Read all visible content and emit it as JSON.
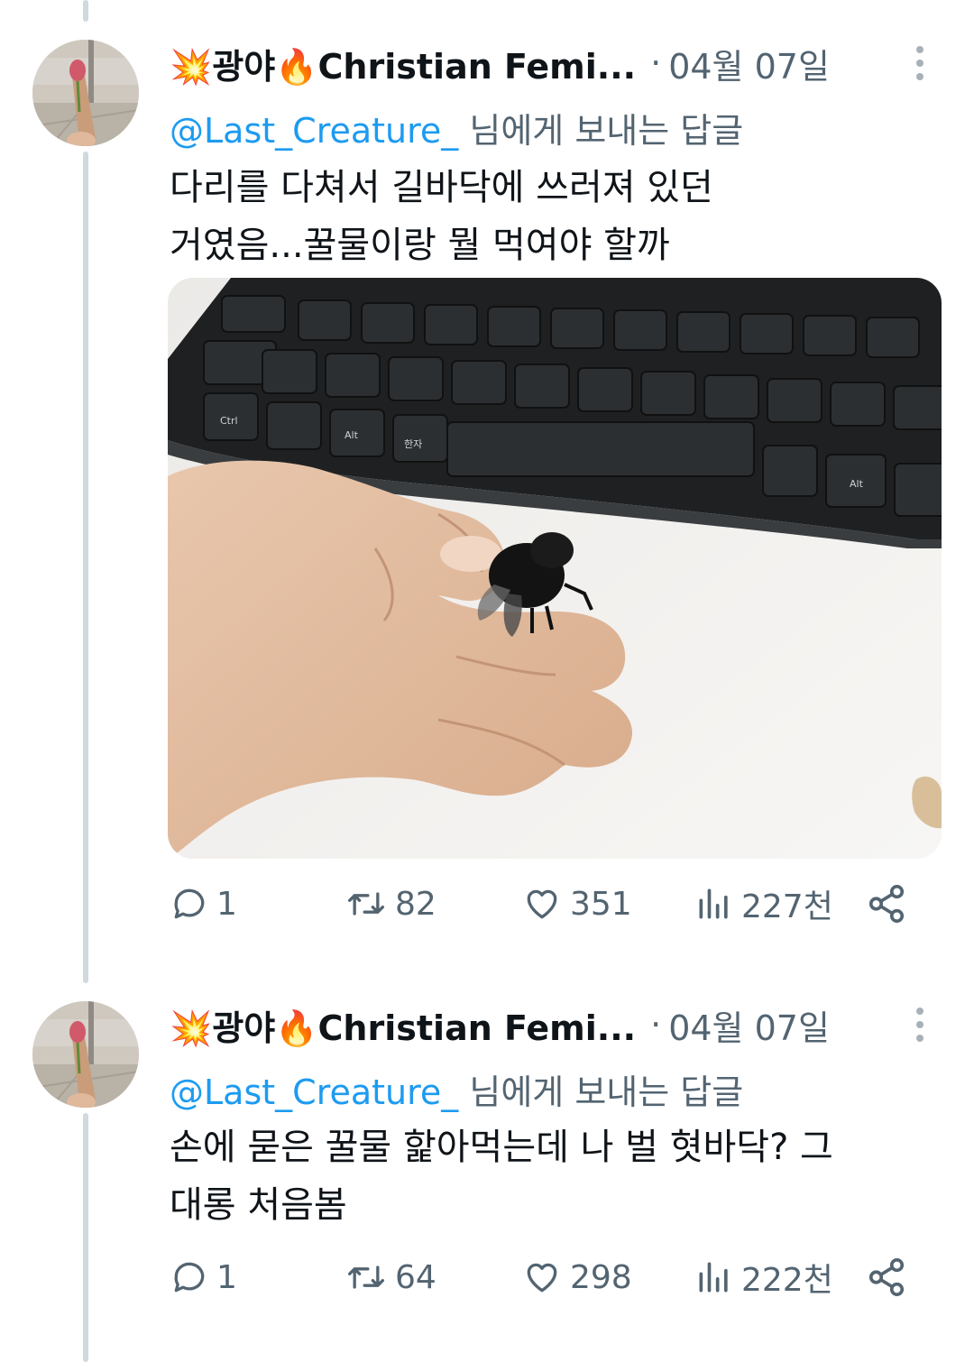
{
  "tweets": [
    {
      "name": "💥광야🔥Christian Femi...",
      "separator": "·",
      "date": "04월 07일",
      "reply_handle": "@Last_Creature_",
      "reply_suffix": " 님에게 보내는 답글",
      "text_lines": [
        "다리를 다쳐서 길바닥에 쓰러져 있던",
        "거였음...꿀물이랑 뭘 먹여야 할까"
      ],
      "has_photo": true,
      "photo_keyboard_keys": [
        "Alt",
        "Ctrl",
        "한자",
        "Alt"
      ],
      "replies": "1",
      "retweets": "82",
      "likes": "351",
      "views": "227천"
    },
    {
      "name": "💥광야🔥Christian Femi...",
      "separator": "·",
      "date": "04월 07일",
      "reply_handle": "@Last_Creature_",
      "reply_suffix": " 님에게 보내는 답글",
      "text_lines": [
        "손에 묻은 꿀물 핥아먹는데 나 벌 혓바닥? 그",
        "대롱 처음봄"
      ],
      "has_photo": false,
      "replies": "1",
      "retweets": "64",
      "likes": "298",
      "views": "222천"
    }
  ],
  "icons": {
    "reply": "speech-bubble-icon",
    "retweet": "retweet-arrows-icon",
    "like": "heart-icon",
    "views": "bar-chart-icon",
    "share": "share-nodes-icon",
    "more": "vertical-dots-icon"
  },
  "colors": {
    "text": "#0f1419",
    "secondary": "#536471",
    "link": "#1d9bf0",
    "thread_line": "#cfd9de"
  }
}
